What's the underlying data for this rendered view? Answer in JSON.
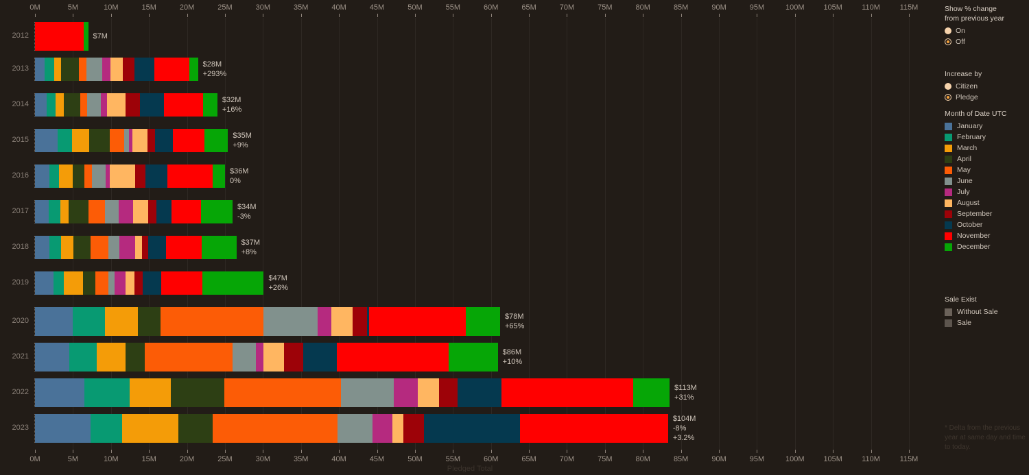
{
  "chart_data": {
    "type": "bar",
    "title": "",
    "xlabel": "Pledged Total",
    "ylabel": "",
    "xlim": [
      0,
      118
    ],
    "xticks": [
      "0M",
      "5M",
      "10M",
      "15M",
      "20M",
      "25M",
      "30M",
      "35M",
      "40M",
      "45M",
      "50M",
      "55M",
      "60M",
      "65M",
      "70M",
      "75M",
      "80M",
      "85M",
      "90M",
      "95M",
      "100M",
      "105M",
      "110M",
      "115M"
    ],
    "grid": true,
    "stacked": true,
    "legend_position": "right",
    "categories": [
      "2012",
      "2013",
      "2014",
      "2015",
      "2016",
      "2017",
      "2018",
      "2019",
      "2020",
      "2021",
      "2022",
      "2023"
    ],
    "series": [
      {
        "name": "January",
        "color": "#4a7299",
        "values": [
          0,
          1.25,
          1.5,
          3.0,
          1.9,
          1.8,
          1.9,
          2.4,
          5.0,
          4.5,
          6.5,
          7.3
        ]
      },
      {
        "name": "February",
        "color": "#089a72",
        "values": [
          0,
          1.3,
          1.2,
          1.9,
          1.3,
          1.5,
          1.5,
          1.4,
          4.2,
          3.6,
          6.0,
          4.2
        ]
      },
      {
        "name": "March",
        "color": "#f49c08",
        "values": [
          0,
          0.9,
          1.1,
          2.2,
          1.8,
          1.1,
          1.7,
          2.5,
          4.3,
          3.8,
          5.4,
          7.4
        ]
      },
      {
        "name": "April",
        "color": "#2d3f14",
        "values": [
          0,
          2.3,
          2.2,
          2.7,
          1.5,
          2.6,
          2.2,
          1.6,
          3.0,
          2.5,
          7.0,
          4.5
        ]
      },
      {
        "name": "May",
        "color": "#fc5c06",
        "values": [
          0,
          1.0,
          0.9,
          1.9,
          1.0,
          2.2,
          2.4,
          1.8,
          13.6,
          11.6,
          15.4,
          16.4
        ]
      },
      {
        "name": "June",
        "color": "#81918d",
        "values": [
          0,
          2.1,
          1.8,
          0.7,
          1.8,
          1.8,
          1.4,
          0.8,
          7.1,
          3.1,
          6.9,
          4.6
        ]
      },
      {
        "name": "July",
        "color": "#b52a7f",
        "values": [
          0,
          1.1,
          0.8,
          0.4,
          0.5,
          1.9,
          2.1,
          1.4,
          1.8,
          1.0,
          3.2,
          2.6
        ]
      },
      {
        "name": "August",
        "color": "#ffb661",
        "values": [
          0,
          1.6,
          2.4,
          2.0,
          3.4,
          2.0,
          0.9,
          1.2,
          2.8,
          2.7,
          2.8,
          1.5
        ]
      },
      {
        "name": "September",
        "color": "#9d0208",
        "values": [
          0,
          1.5,
          1.9,
          1.0,
          1.3,
          1.1,
          0.8,
          1.1,
          1.9,
          2.5,
          2.4,
          2.7
        ]
      },
      {
        "name": "October",
        "color": "#05394f",
        "values": [
          0,
          2.7,
          3.2,
          2.3,
          2.9,
          2.0,
          2.3,
          2.4,
          0.3,
          4.4,
          5.8,
          12.6
        ]
      },
      {
        "name": "November",
        "color": "#ff0000",
        "values": [
          6.4,
          4.6,
          5.1,
          4.2,
          6.0,
          3.8,
          4.7,
          5.4,
          12.7,
          14.7,
          17.3,
          19.5
        ]
      },
      {
        "name": "December",
        "color": "#06a606",
        "values": [
          0.6,
          1.1,
          1.9,
          3.1,
          1.6,
          4.2,
          4.6,
          8.1,
          4.5,
          6.5,
          4.8,
          0
        ]
      }
    ],
    "bar_labels": [
      {
        "year": "2012",
        "total": "$7M",
        "delta": "",
        "delta2": ""
      },
      {
        "year": "2013",
        "total": "$28M",
        "delta": "+293%",
        "delta2": ""
      },
      {
        "year": "2014",
        "total": "$32M",
        "delta": "+16%",
        "delta2": ""
      },
      {
        "year": "2015",
        "total": "$35M",
        "delta": "+9%",
        "delta2": ""
      },
      {
        "year": "2016",
        "total": "$36M",
        "delta": "0%",
        "delta2": ""
      },
      {
        "year": "2017",
        "total": "$34M",
        "delta": "-3%",
        "delta2": ""
      },
      {
        "year": "2018",
        "total": "$37M",
        "delta": "+8%",
        "delta2": ""
      },
      {
        "year": "2019",
        "total": "$47M",
        "delta": "+26%",
        "delta2": ""
      },
      {
        "year": "2020",
        "total": "$78M",
        "delta": "+65%",
        "delta2": ""
      },
      {
        "year": "2021",
        "total": "$86M",
        "delta": "+10%",
        "delta2": ""
      },
      {
        "year": "2022",
        "total": "$113M",
        "delta": "+31%",
        "delta2": ""
      },
      {
        "year": "2023",
        "total": "$104M",
        "delta": "-8%",
        "delta2": "+3.2%"
      }
    ]
  },
  "panel": {
    "show_change": {
      "title_line1": "Show % change",
      "title_line2": "from previous year",
      "options": [
        {
          "label": "On",
          "selected": false
        },
        {
          "label": "Off",
          "selected": true
        }
      ]
    },
    "increase_by": {
      "title": "Increase by",
      "options": [
        {
          "label": "Citizen",
          "selected": false
        },
        {
          "label": "Pledge",
          "selected": true
        }
      ]
    },
    "month_legend": {
      "title": "Month of Date UTC",
      "items": [
        {
          "label": "January",
          "color": "#4a7299"
        },
        {
          "label": "February",
          "color": "#089a72"
        },
        {
          "label": "March",
          "color": "#f49c08"
        },
        {
          "label": "April",
          "color": "#2d3f14"
        },
        {
          "label": "May",
          "color": "#fc5c06"
        },
        {
          "label": "June",
          "color": "#81918d"
        },
        {
          "label": "July",
          "color": "#b52a7f"
        },
        {
          "label": "August",
          "color": "#ffb661"
        },
        {
          "label": "September",
          "color": "#9d0208"
        },
        {
          "label": "October",
          "color": "#05394f"
        },
        {
          "label": "November",
          "color": "#ff0000"
        },
        {
          "label": "December",
          "color": "#06a606"
        }
      ]
    },
    "sale_legend": {
      "title": "Sale Exist",
      "items": [
        {
          "label": "Without Sale",
          "color": "#6b625a"
        },
        {
          "label": "Sale",
          "color": "#5d554e"
        }
      ]
    },
    "footnote": "* Delta from the previous year at same day and time to today."
  }
}
